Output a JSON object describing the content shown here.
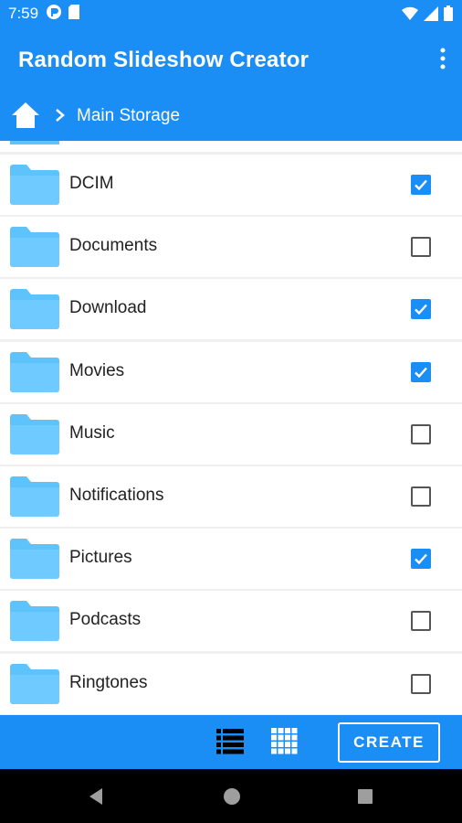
{
  "status_bar": {
    "time": "7:59"
  },
  "app": {
    "title": "Random Slideshow Creator"
  },
  "breadcrumb": {
    "current": "Main Storage"
  },
  "folders": [
    {
      "name": "DCIM",
      "checked": true
    },
    {
      "name": "Documents",
      "checked": false
    },
    {
      "name": "Download",
      "checked": true
    },
    {
      "name": "Movies",
      "checked": true
    },
    {
      "name": "Music",
      "checked": false
    },
    {
      "name": "Notifications",
      "checked": false
    },
    {
      "name": "Pictures",
      "checked": true
    },
    {
      "name": "Podcasts",
      "checked": false
    },
    {
      "name": "Ringtones",
      "checked": false
    }
  ],
  "bottom_bar": {
    "create_label": "CREATE"
  },
  "colors": {
    "primary": "#1a8ef5",
    "folder": "#5ec2fb",
    "nav": "#000000"
  }
}
